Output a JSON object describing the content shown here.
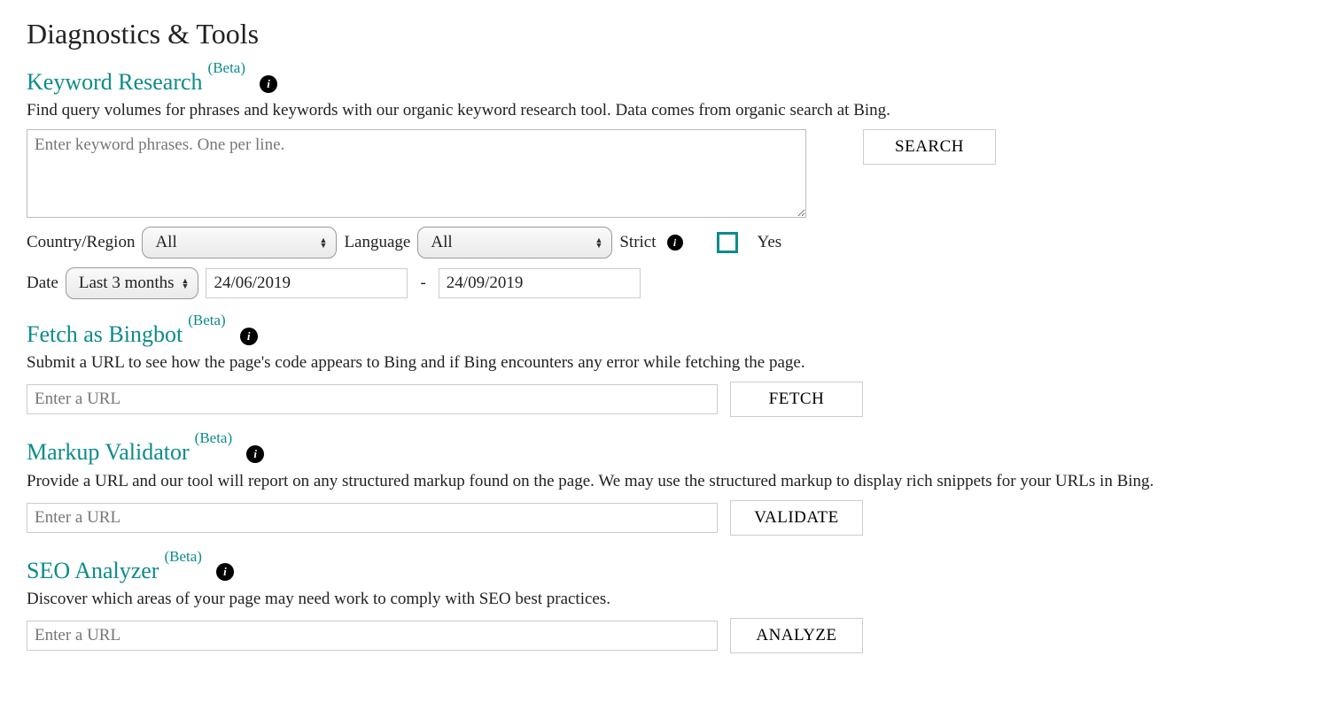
{
  "page": {
    "title": "Diagnostics & Tools"
  },
  "keywordResearch": {
    "title": "Keyword Research",
    "badge": "(Beta)",
    "desc": "Find query volumes for phrases and keywords with our organic keyword research tool. Data comes from organic search at Bing.",
    "placeholder": "Enter keyword phrases. One per line.",
    "searchButton": "SEARCH",
    "countryLabel": "Country/Region",
    "countryValue": "All",
    "languageLabel": "Language",
    "languageValue": "All",
    "strictLabel": "Strict",
    "strictYes": "Yes",
    "dateLabel": "Date",
    "dateRangeValue": "Last 3 months",
    "dateFrom": "24/06/2019",
    "dateTo": "24/09/2019",
    "dash": "-"
  },
  "fetchBingbot": {
    "title": "Fetch as Bingbot",
    "badge": "(Beta)",
    "desc": "Submit a URL to see how the page's code appears to Bing and if Bing encounters any error while fetching the page.",
    "placeholder": "Enter a URL",
    "button": "FETCH"
  },
  "markupValidator": {
    "title": "Markup Validator",
    "badge": "(Beta)",
    "desc": "Provide a URL and our tool will report on any structured markup found on the page. We may use the structured markup to display rich snippets for your URLs in Bing.",
    "placeholder": "Enter a URL",
    "button": "VALIDATE"
  },
  "seoAnalyzer": {
    "title": "SEO Analyzer",
    "badge": "(Beta)",
    "desc": "Discover which areas of your page may need work to comply with SEO best practices.",
    "placeholder": "Enter a URL",
    "button": "ANALYZE"
  }
}
